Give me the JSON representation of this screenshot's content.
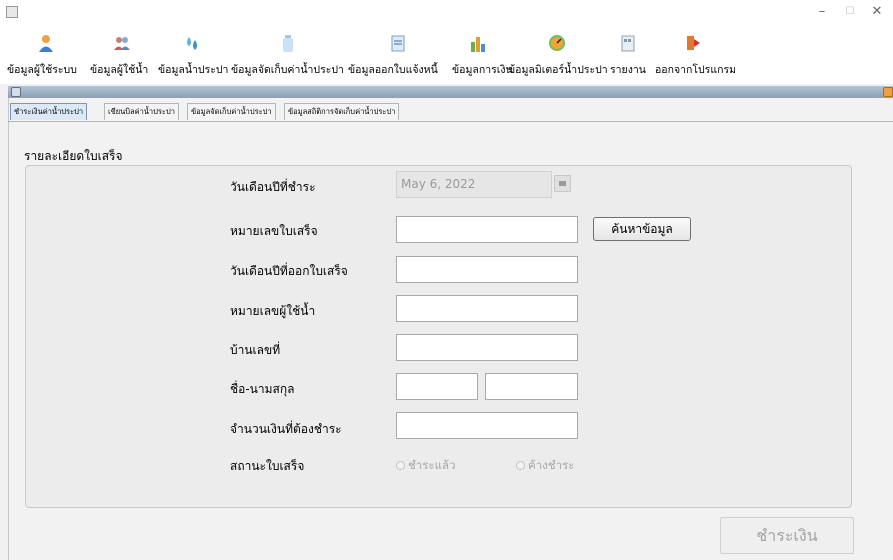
{
  "menu": {
    "items": [
      {
        "label": "ข้อมูลผู้ใช้ระบบ",
        "icon": "user-icon"
      },
      {
        "label": "ข้อมูลผู้ใช้น้ำ",
        "icon": "users-icon"
      },
      {
        "label": "ข้อมูลน้ำประปา",
        "icon": "water-drop-icon"
      },
      {
        "label": "ข้อมูลจัดเก็บค่าน้ำประปา",
        "icon": "water-bottle-icon"
      },
      {
        "label": "ข้อมูลออกใบแจ้งหนี้",
        "icon": "invoice-icon"
      },
      {
        "label": "ข้อมูลการเงิน",
        "icon": "finance-icon"
      },
      {
        "label": "ข้อมูลมิเตอร์น้ำประปา",
        "icon": "meter-icon"
      },
      {
        "label": "รายงาน",
        "icon": "report-icon"
      },
      {
        "label": "ออกจากโปรแกรม",
        "icon": "exit-icon"
      }
    ]
  },
  "tabs": [
    {
      "label": "ชำระเงินค่าน้ำประปา",
      "active": true
    },
    {
      "label": "เขียนบิลค่าน้ำประปา",
      "active": false
    },
    {
      "label": "ข้อมูลจัดเก็บค่าน้ำประปา",
      "active": false
    },
    {
      "label": "ข้อมูลสถิติการจัดเก็บค่าน้ำประปา",
      "active": false
    }
  ],
  "form": {
    "section_title": "รายละเอียดใบเสร็จ",
    "date_label": "วันเดือนปีที่ชำระ",
    "date_value": "May 6, 2022",
    "receipt_no_label": "หมายเลขใบเสร็จ",
    "receipt_no_value": "",
    "search_button": "ค้นหาข้อมูล",
    "issue_date_label": "วันเดือนปีที่ออกใบเสร็จ",
    "issue_date_value": "",
    "user_no_label": "หมายเลขผู้ใช้น้ำ",
    "user_no_value": "",
    "house_no_label": "บ้านเลขที่",
    "house_no_value": "",
    "name_label": "ชื่อ-นามสกุล",
    "first_name_value": "",
    "last_name_value": "",
    "amount_label": "จำนวนเงินที่ต้องชำระ",
    "amount_value": "",
    "status_label": "สถานะใบเสร็จ",
    "status_options": [
      "ชำระแล้ว",
      "ค้างชำระ"
    ],
    "pay_button": "ชำระเงิน"
  },
  "colors": {
    "active_tab": "#dbe8f5",
    "panel_bar": "#8aa0b5",
    "close_accent": "#f0a040"
  }
}
